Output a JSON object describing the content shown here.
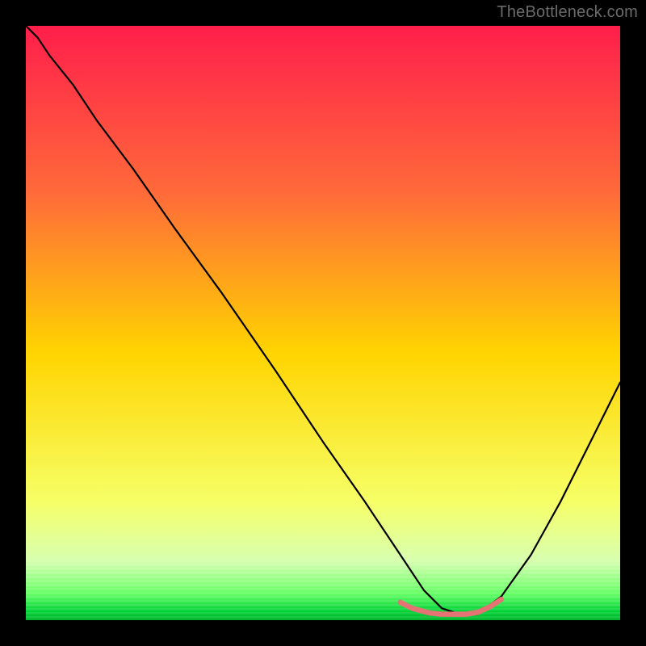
{
  "watermark": "TheBottleneck.com",
  "colors": {
    "bg": "#000000",
    "curve": "#000000",
    "accent": "#e57373",
    "green_band": "#00e840",
    "green_band_light": "#c8ffc8",
    "yellow_mid": "#ffe900",
    "orange_mid": "#ff8a2a",
    "red_top": "#ff1e4b"
  },
  "chart_data": {
    "type": "line",
    "title": "",
    "xlabel": "",
    "ylabel": "",
    "xlim": [
      0,
      100
    ],
    "ylim": [
      0,
      100
    ],
    "series": [
      {
        "name": "bottleneck-curve",
        "x": [
          0,
          2,
          4,
          8,
          12,
          18,
          25,
          33,
          42,
          50,
          57,
          63,
          67,
          70,
          73,
          76,
          80,
          85,
          90,
          95,
          100
        ],
        "values": [
          100,
          98,
          95,
          90,
          84,
          76,
          66,
          55,
          42,
          30,
          20,
          11,
          5,
          2,
          1,
          1,
          4,
          11,
          20,
          30,
          40
        ]
      }
    ],
    "accent_segment": {
      "name": "optimal-range-marker",
      "x": [
        63,
        65,
        68,
        70,
        72,
        74,
        76,
        78,
        80
      ],
      "values": [
        3.0,
        2.0,
        1.2,
        1.0,
        1.0,
        1.0,
        1.3,
        2.2,
        3.5
      ]
    },
    "gradient_stops": [
      {
        "offset": 0.0,
        "color": "#ff1e4b"
      },
      {
        "offset": 0.28,
        "color": "#ff6a3a"
      },
      {
        "offset": 0.55,
        "color": "#ffd400"
      },
      {
        "offset": 0.8,
        "color": "#f6ff66"
      },
      {
        "offset": 0.9,
        "color": "#d8ffb0"
      },
      {
        "offset": 0.955,
        "color": "#66ff66"
      },
      {
        "offset": 0.985,
        "color": "#00d235"
      },
      {
        "offset": 1.0,
        "color": "#00b52c"
      }
    ]
  }
}
